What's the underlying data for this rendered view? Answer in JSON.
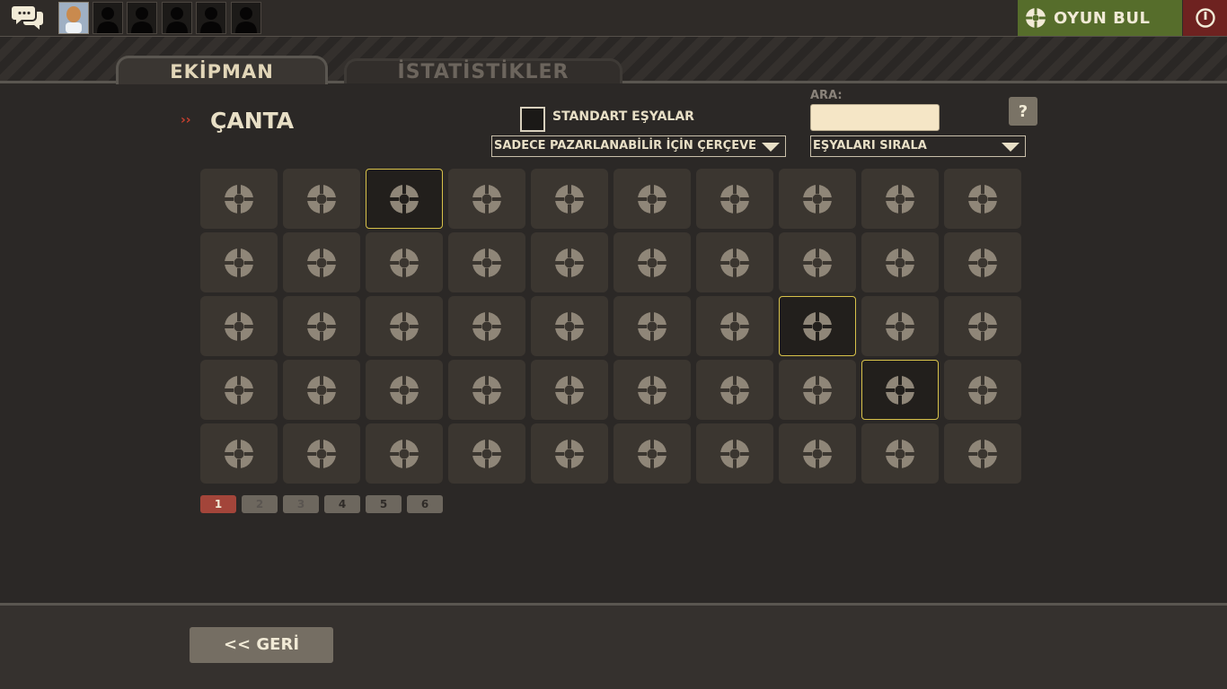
{
  "topbar": {
    "friends": [
      {
        "type": "avatar"
      },
      {
        "type": "silhouette"
      },
      {
        "type": "silhouette"
      },
      {
        "type": "silhouette"
      },
      {
        "type": "silhouette"
      },
      {
        "type": "silhouette"
      }
    ],
    "find_game_label": "OYUN BUL",
    "icons": {
      "chat": "chat-bubbles-icon",
      "find_game": "tf2-logo-icon",
      "quit": "power-icon"
    },
    "colors": {
      "find_game": "#566d2b",
      "quit": "#6e2220"
    }
  },
  "tabs": [
    {
      "label": "EKİPMAN",
      "active": true
    },
    {
      "label": "İSTATİSTİKLER",
      "active": false
    }
  ],
  "bag": {
    "title": "ÇANTA",
    "arrow": "››",
    "standard_items_label": "STANDART EŞYALAR",
    "standard_items_checked": false,
    "search_label": "ARA:",
    "search_value": "",
    "help_label": "?",
    "filter_dropdown": "SADECE PAZARLANABİLİR İÇİN ÇERÇEVE",
    "sort_dropdown": "EŞYALARI SIRALA"
  },
  "grid": {
    "rows": 5,
    "cols": 10,
    "selected_slots": [
      [
        0,
        2
      ],
      [
        2,
        7
      ],
      [
        3,
        8
      ]
    ],
    "slot_icon": "tf2-logo-icon",
    "highlight_color": "#d8c24a"
  },
  "pagination": {
    "pages": [
      "1",
      "2",
      "3",
      "4",
      "5",
      "6"
    ],
    "active_page": "1"
  },
  "footer": {
    "back_label": "<< GERİ"
  }
}
